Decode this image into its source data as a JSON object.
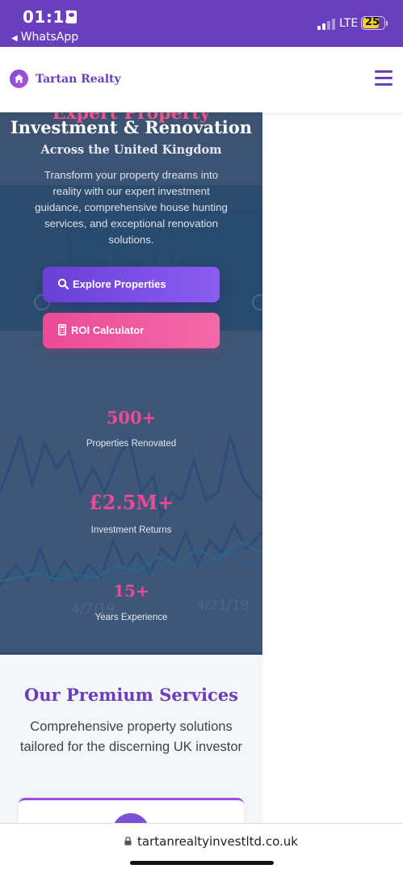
{
  "status_bar": {
    "time": "01:13",
    "back_app": "WhatsApp",
    "network": "LTE",
    "battery": "25"
  },
  "header": {
    "brand": "Tartan Realty",
    "logo_icon": "house-icon",
    "menu_icon": "hamburger-menu-icon",
    "accent_color": "#6a3fbf"
  },
  "hero": {
    "cut_title": "Expert Property",
    "title": "Investment & Renovation",
    "subtitle": "Across the United Kingdom",
    "description": "Transform your property dreams into reality with our expert investment guidance, comprehensive house hunting services, and exceptional renovation solutions.",
    "background_texts": [
      "Average CTR",
      "1.2%",
      "4/7/19",
      "4/21/19"
    ],
    "buttons": {
      "explore": {
        "label": "Explore Properties",
        "icon": "search-icon"
      },
      "roi": {
        "label": "ROI Calculator",
        "icon": "calculator-icon"
      }
    },
    "stats": [
      {
        "value": "500+",
        "label": "Properties Renovated"
      },
      {
        "value": "£2.5M+",
        "label": "Investment Returns"
      },
      {
        "value": "15+",
        "label": "Years Experience"
      }
    ]
  },
  "services": {
    "title": "Our Premium Services",
    "description": "Comprehensive property solutions tailored for the discerning UK investor"
  },
  "browser": {
    "url": "tartanrealtyinvestltd.co.uk",
    "lock_icon": "lock-icon"
  },
  "colors": {
    "primary": "#6a3fbf",
    "pink": "#ec4a97",
    "hero_bg": "#3d5676"
  }
}
